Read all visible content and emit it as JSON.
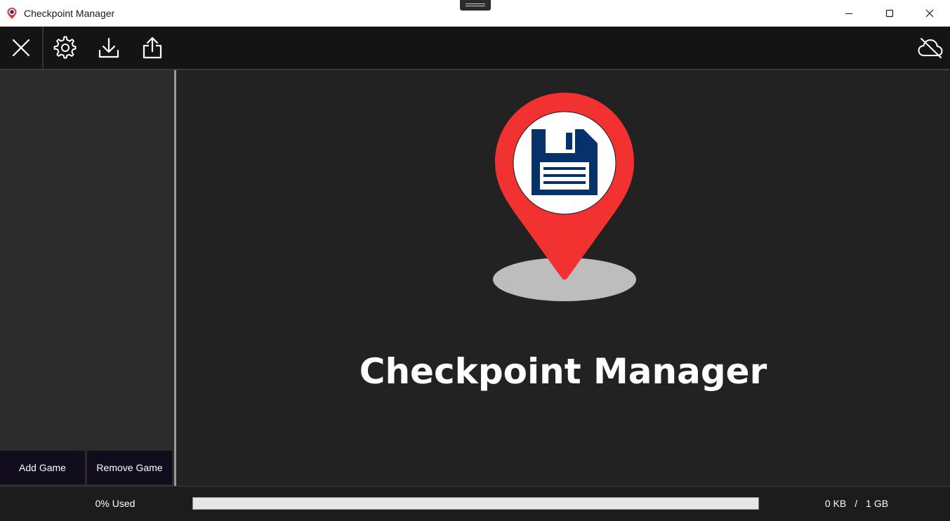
{
  "window": {
    "title": "Checkpoint Manager"
  },
  "toolbar": {
    "buttons": [
      {
        "icon": "close-icon"
      },
      {
        "icon": "gear-icon"
      },
      {
        "icon": "download-icon"
      },
      {
        "icon": "share-upload-icon"
      }
    ],
    "cloud_status_icon": "cloud-off-icon"
  },
  "sidebar": {
    "add_label": "Add Game",
    "remove_label": "Remove Game"
  },
  "main": {
    "heading": "Checkpoint Manager",
    "logo": "map-pin-floppy-disk-logo",
    "colors": {
      "pin": "#f23131",
      "disk": "#06316b",
      "shadow": "#bdbdbd"
    }
  },
  "status": {
    "used_label": "0% Used",
    "used_fraction": 0,
    "used_size": "0 KB",
    "separator": "/",
    "total_size": "1 GB"
  }
}
